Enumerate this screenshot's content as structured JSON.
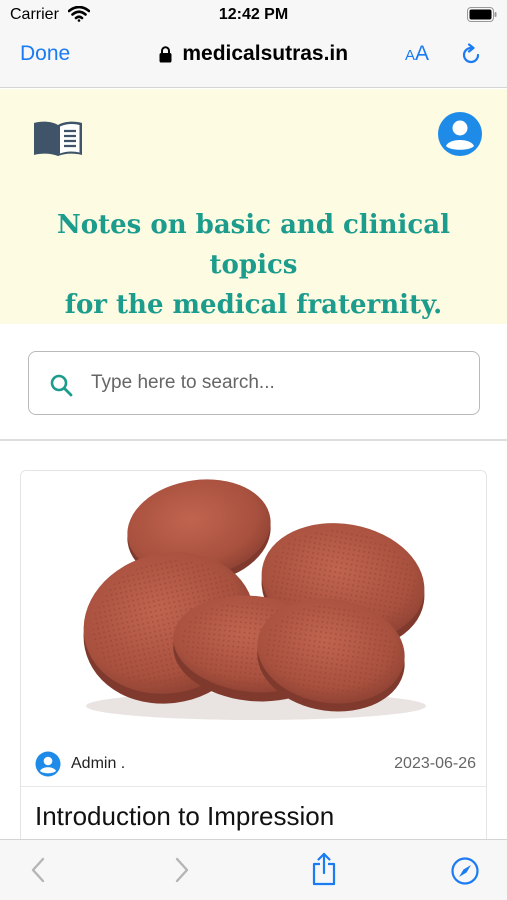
{
  "status_bar": {
    "carrier": "Carrier",
    "time": "12:42 PM"
  },
  "browser": {
    "done_label": "Done",
    "url": "medicalsutras.in",
    "text_size_small": "A",
    "text_size_large": "A"
  },
  "hero": {
    "tagline_line1": "Notes on basic and clinical topics",
    "tagline_line2": "for the medical fraternity."
  },
  "search": {
    "placeholder": "Type here to search..."
  },
  "post": {
    "author": "Admin .",
    "date": "2023-06-26",
    "title": "Introduction to Impression"
  },
  "colors": {
    "accent_blue": "#1a7bf2",
    "teal_heading": "#1c9c8c",
    "hero_background": "#fdfbe1",
    "disc_brown": "#a9513f"
  },
  "icons": [
    "wifi-icon",
    "battery-icon",
    "lock-icon",
    "reload-icon",
    "book-icon",
    "user-icon",
    "search-icon",
    "back-icon",
    "forward-icon",
    "share-icon",
    "compass-icon"
  ]
}
